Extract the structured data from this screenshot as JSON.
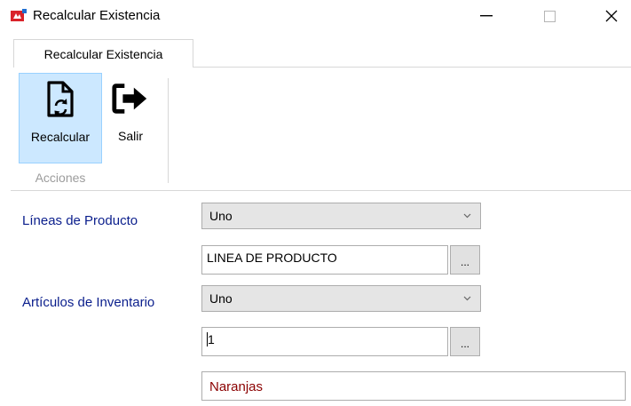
{
  "window": {
    "title": "Recalcular Existencia",
    "minimize_symbol": "—",
    "maximize_symbol": "☐",
    "close_symbol": "✕"
  },
  "ribbon": {
    "tab_label": "Recalcular Existencia",
    "buttons": [
      {
        "label": "Recalcular",
        "icon": "document-refresh-icon",
        "selected": true
      },
      {
        "label": "Salir",
        "icon": "exit-icon",
        "selected": false
      }
    ],
    "group_label": "Acciones"
  },
  "form": {
    "lineas_label": "Líneas de Producto",
    "lineas_combo_value": "Uno",
    "lineas_text_value": "LINEA DE PRODUCTO",
    "lineas_browse_label": "...",
    "articulos_label": "Artículos de Inventario",
    "articulos_combo_value": "Uno",
    "articulos_text_value": "1",
    "articulos_browse_label": "...",
    "articulo_description": "Naranjas"
  },
  "colors": {
    "label_text": "#0a1e8c",
    "description_text": "#8b0000",
    "selected_button_bg": "#cce8ff"
  }
}
